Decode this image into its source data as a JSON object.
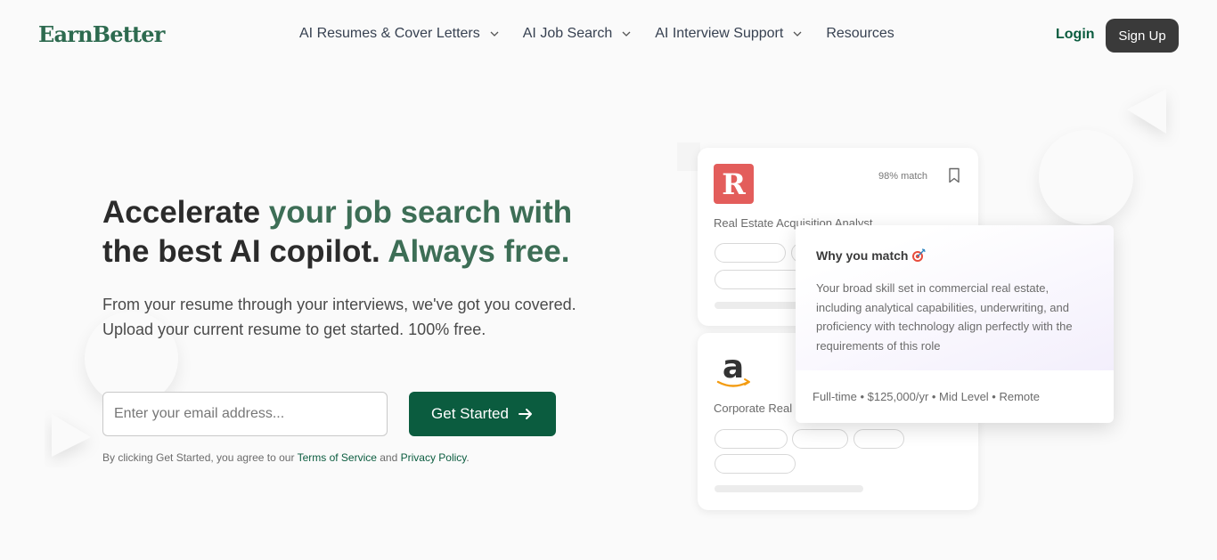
{
  "header": {
    "logo": "EarnBetter",
    "nav": [
      {
        "label": "AI Resumes & Cover Letters",
        "has_dropdown": true
      },
      {
        "label": "AI Job Search",
        "has_dropdown": true
      },
      {
        "label": "AI Interview Support",
        "has_dropdown": true
      },
      {
        "label": "Resources",
        "has_dropdown": false
      }
    ],
    "login": "Login",
    "signup": "Sign Up"
  },
  "hero": {
    "title_part1": "Accelerate ",
    "title_part2": "your job search with",
    "title_part3": "the best AI copilot. ",
    "title_part4": "Always free.",
    "subtitle": "From your resume through your interviews, we've got you covered. Upload your current resume to get started. 100% free.",
    "email_placeholder": "Enter your email address...",
    "cta": "Get Started",
    "legal_prefix": "By clicking Get Started, you agree to our ",
    "terms": "Terms of Service",
    "legal_and": " and ",
    "privacy": "Privacy Policy",
    "legal_suffix": "."
  },
  "cards": {
    "card1": {
      "logo_letter": "R",
      "match": "98% match",
      "title": "Real Estate Acquisition Analyst"
    },
    "card2": {
      "title": "Corporate Real Estate Analyst"
    },
    "why": {
      "title": "Why you match",
      "body": "Your broad skill set in commercial real estate, including analytical capabilities, underwriting, and proficiency with technology align perfectly with the requirements of this role",
      "footer": "Full-time • $125,000/yr • Mid Level • Remote"
    }
  },
  "colors": {
    "brand_green": "#0b5c3f",
    "title_green": "#3d6e56",
    "signup_bg": "#3a3a3a",
    "r_logo_bg": "#e35d5b"
  },
  "icons": [
    "chevron-down-icon",
    "arrow-right-icon",
    "bookmark-icon",
    "target-icon",
    "amazon-logo"
  ]
}
